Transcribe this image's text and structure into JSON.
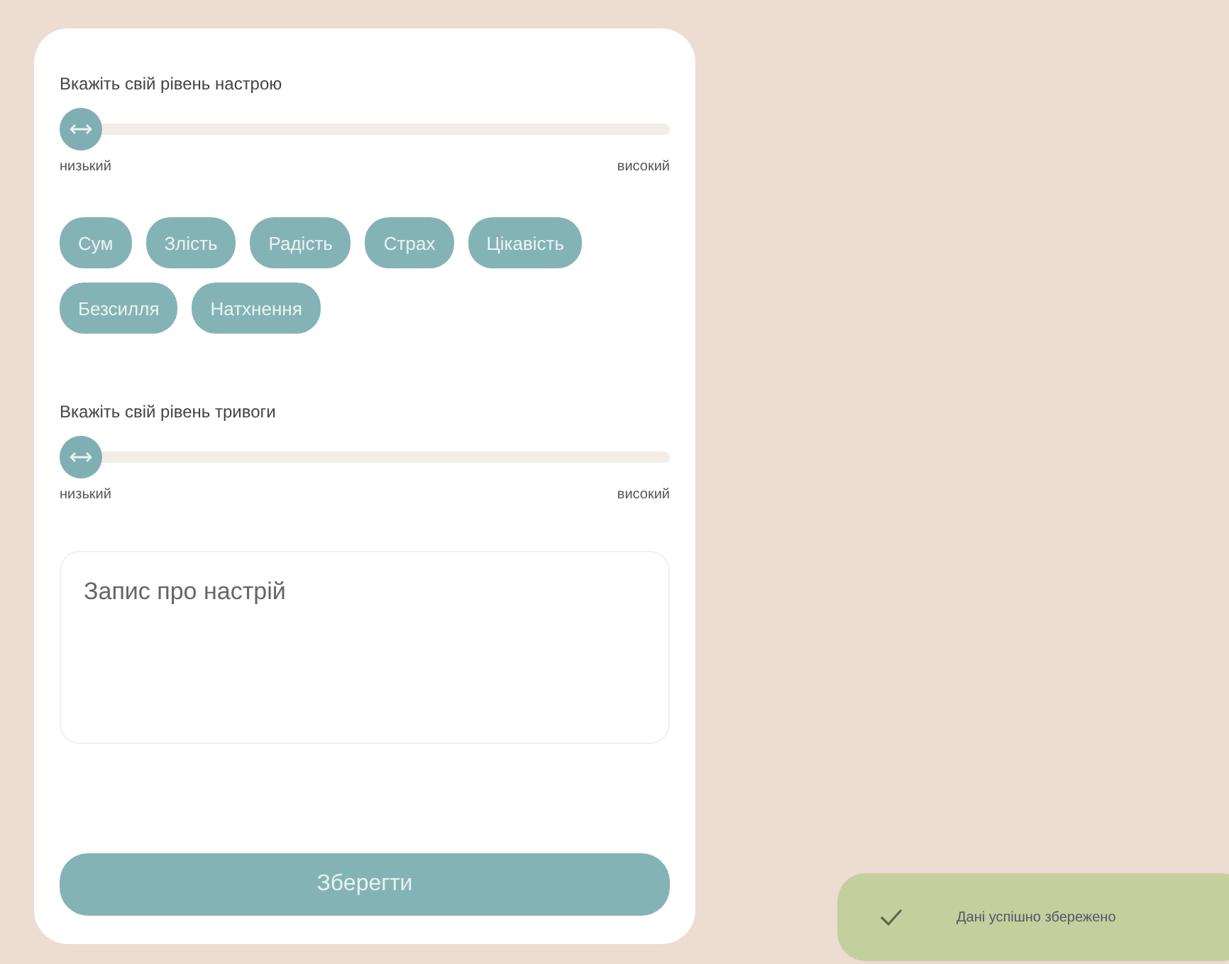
{
  "mood": {
    "label": "Вкажіть свій рівень настрою",
    "level": 0,
    "min_label": "низький",
    "max_label": "високий"
  },
  "emotions": [
    "Сум",
    "Злість",
    "Радість",
    "Страх",
    "Цікавість",
    "Безсилля",
    "Натхнення"
  ],
  "anxiety": {
    "label": "Вкажіть свій рівень тривоги",
    "level": 0,
    "min_label": "низький",
    "max_label": "високий"
  },
  "note": {
    "placeholder": "Запис про настрій"
  },
  "save_button": "Зберегти",
  "toast": {
    "message": "Дані успішно збережено"
  }
}
